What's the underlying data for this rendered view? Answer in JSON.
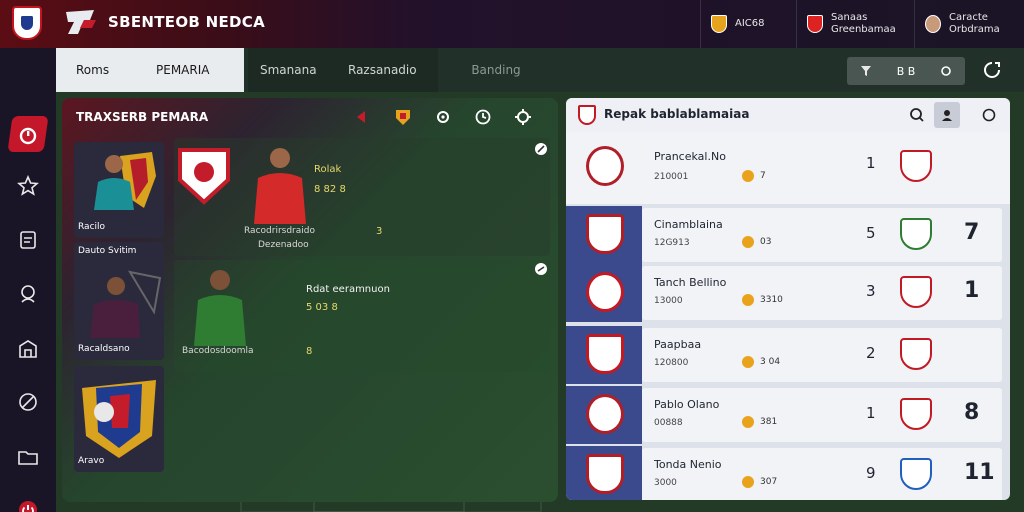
{
  "app": {
    "brand": "SBENTEOB NEDCA"
  },
  "top_users": [
    {
      "label1": "AIC68",
      "label2": "",
      "crest_color": "#e6a41e"
    },
    {
      "label1": "Sanaas",
      "label2": "Greenbamaa",
      "crest_color": "#d22"
    },
    {
      "label1": "Caracte",
      "label2": "Orbdrama",
      "crest_color": "#d22"
    }
  ],
  "tabs": [
    {
      "label": "Roms",
      "active": true
    },
    {
      "label": "PEMARIA",
      "active": true
    },
    {
      "label": "Smanana",
      "active": false
    },
    {
      "label": "Razsanadio",
      "active": false
    },
    {
      "label": "Banding",
      "active": false
    }
  ],
  "tab_btns": {
    "label": "B  B"
  },
  "transfer_panel": {
    "title": "TRAXSERB PEMARA",
    "cards": [
      {
        "label": "Racilo"
      },
      {
        "label": "Dauto Svitim",
        "sub": "Racaldsano"
      },
      {
        "label": "Aravo"
      }
    ],
    "featured": [
      {
        "name": "Rolak",
        "stat": "8  82   8",
        "sub": "Racodrirsdraido",
        "sub2": "Dezenadoo",
        "extra": "3"
      },
      {
        "name": "Rdat eeramnuon",
        "stat": "5  03   8",
        "sub": "Bacodosdoomla",
        "extra": "8"
      }
    ]
  },
  "ranking_panel": {
    "title": "Repak bablablamaiaa",
    "rows": [
      {
        "name": "Prancekal.No",
        "pts": "210001",
        "val": "7",
        "pos": "1",
        "score": "",
        "opp_color": "#c21a25",
        "crest_color": "#b01e28"
      },
      {
        "name": "Cinamblaina",
        "pts": "12G913",
        "val": "03",
        "pos": "5",
        "score": "7",
        "opp_color": "#2e7d32",
        "crest_color": "#b01e28"
      },
      {
        "name": "Tanch Bellino",
        "pts": "13000",
        "val": "3310",
        "pos": "3",
        "score": "1",
        "opp_color": "#c21a25",
        "crest_color": "#c21a25"
      },
      {
        "name": "Paapbaa",
        "pts": "120800",
        "val": "3 04",
        "pos": "2",
        "score": "",
        "opp_color": "#c21a25",
        "crest_color": "#c21a25"
      },
      {
        "name": "Pablo Olano",
        "pts": "00888",
        "val": "381",
        "pos": "1",
        "score": "8",
        "opp_color": "#c21a25",
        "crest_color": "#b01e28"
      },
      {
        "name": "Tonda Nenio",
        "pts": "3000",
        "val": "307",
        "pos": "9",
        "score": "11",
        "opp_color": "#1f5fbf",
        "crest_color": "#b01e28"
      }
    ]
  }
}
